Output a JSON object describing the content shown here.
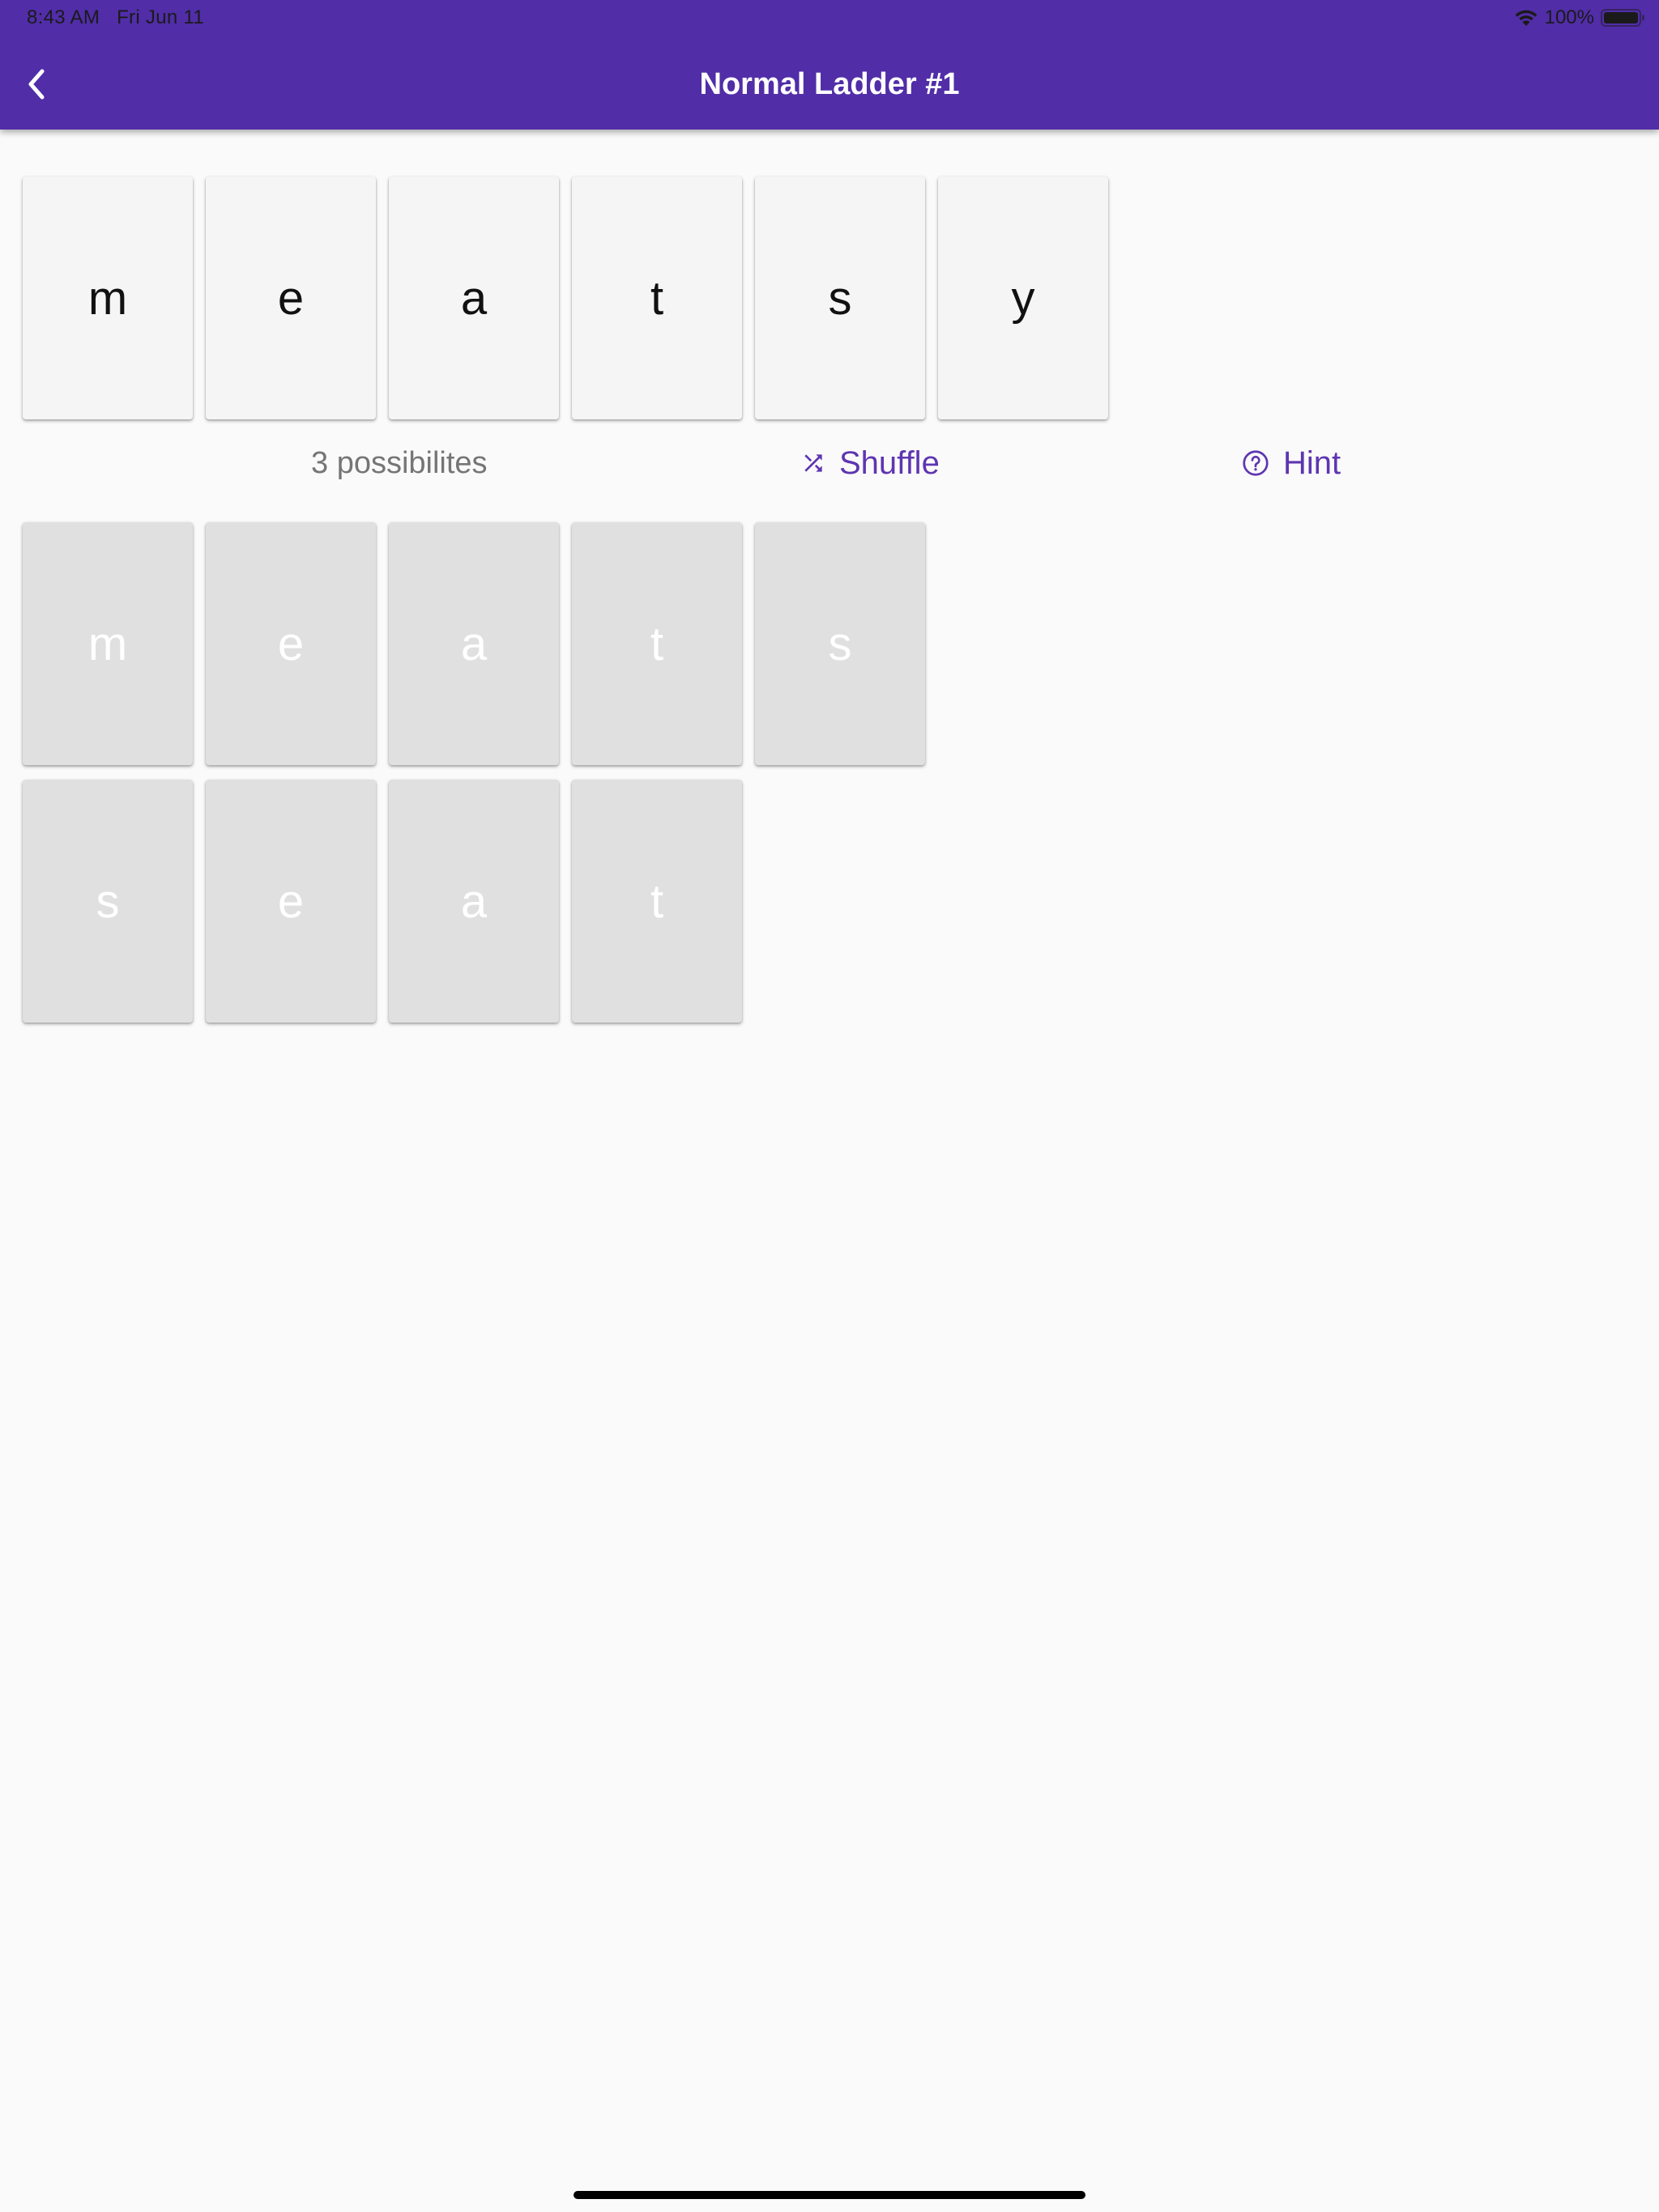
{
  "status_bar": {
    "time": "8:43 AM",
    "date": "Fri Jun 11",
    "battery": "100%",
    "icons": [
      "wifi-icon",
      "battery-icon"
    ]
  },
  "app_bar": {
    "back_icon": "chevron-left-icon",
    "title": "Normal Ladder #1"
  },
  "letters": [
    "m",
    "e",
    "a",
    "t",
    "s",
    "y"
  ],
  "controls": {
    "possibilities_text": "3 possibilites",
    "shuffle_label": "Shuffle",
    "shuffle_icon": "shuffle-icon",
    "hint_label": "Hint",
    "hint_icon": "help-circle-icon"
  },
  "solved_words": [
    [
      "m",
      "e",
      "a",
      "t",
      "s"
    ],
    [
      "s",
      "e",
      "a",
      "t"
    ]
  ],
  "colors": {
    "primary": "#512da8",
    "accent": "#5e35b1",
    "letter_tile": "#f5f5f5",
    "solved_tile": "#e0e0e0",
    "background": "#fafafa"
  }
}
